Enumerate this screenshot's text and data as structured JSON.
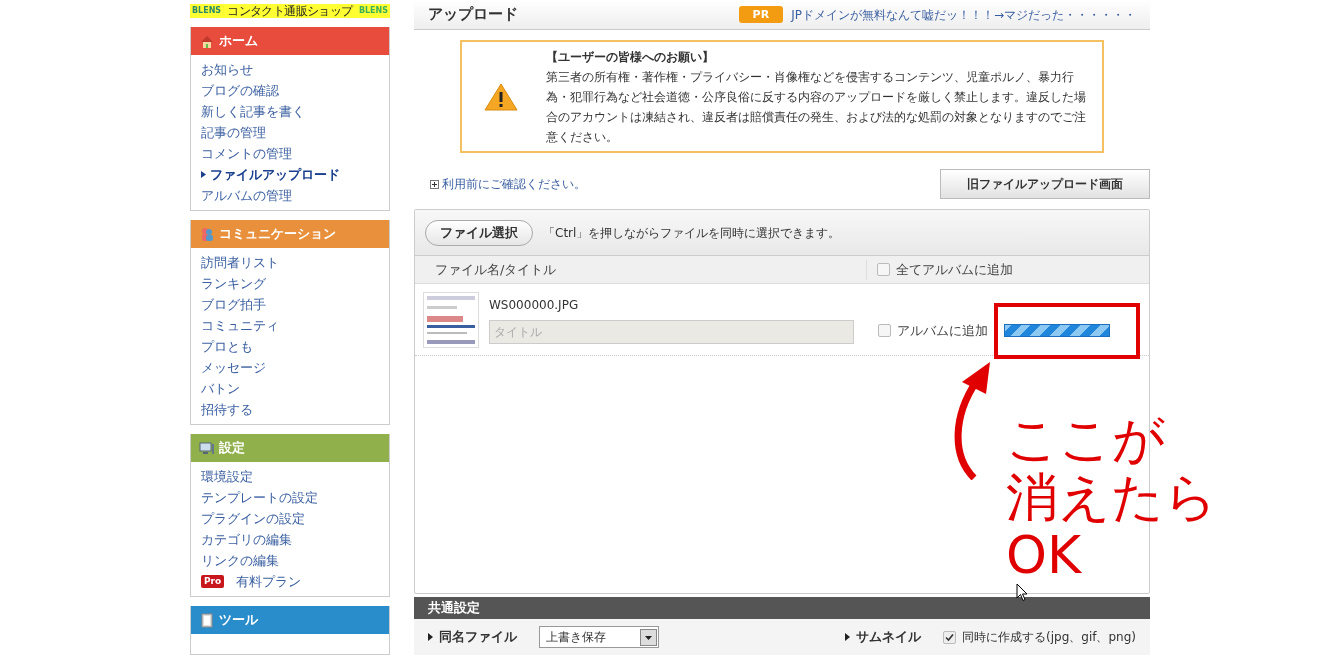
{
  "logo": {
    "brand": "BLENS",
    "tagline": "コンタクト通販ショップ",
    "brand_right": "BLENS"
  },
  "sidebar": [
    {
      "title": "ホーム",
      "kind": "home",
      "color": "#e84c3d",
      "items": [
        {
          "label": "お知らせ",
          "selected": false
        },
        {
          "label": "ブログの確認",
          "selected": false
        },
        {
          "label": "新しく記事を書く",
          "selected": false
        },
        {
          "label": "記事の管理",
          "selected": false
        },
        {
          "label": "コメントの管理",
          "selected": false
        },
        {
          "label": "ファイルアップロード",
          "selected": true
        },
        {
          "label": "アルバムの管理",
          "selected": false
        }
      ]
    },
    {
      "title": "コミュニケーション",
      "kind": "people",
      "color": "#e8903c",
      "items": [
        {
          "label": "訪問者リスト",
          "selected": false
        },
        {
          "label": "ランキング",
          "selected": false
        },
        {
          "label": "ブログ拍手",
          "selected": false
        },
        {
          "label": "コミュニティ",
          "selected": false
        },
        {
          "label": "プロとも",
          "selected": false
        },
        {
          "label": "メッセージ",
          "selected": false
        },
        {
          "label": "バトン",
          "selected": false
        },
        {
          "label": "招待する",
          "selected": false
        }
      ]
    },
    {
      "title": "設定",
      "kind": "monitor",
      "color": "#8fb04a",
      "items": [
        {
          "label": "環境設定",
          "selected": false
        },
        {
          "label": "テンプレートの設定",
          "selected": false
        },
        {
          "label": "プラグインの設定",
          "selected": false
        },
        {
          "label": "カテゴリの編集",
          "selected": false
        },
        {
          "label": "リンクの編集",
          "selected": false
        },
        {
          "label": "有料プラン",
          "selected": false,
          "badge": "Pro"
        }
      ]
    },
    {
      "title": "ツール",
      "kind": "book",
      "color": "#2a8dcb"
    }
  ],
  "header": {
    "title": "アップロード",
    "pr_badge": "PR",
    "pr_text": "JPドメインが無料なんて嘘だッ！！！→マジだった・・・・・・"
  },
  "notice": {
    "heading": "【ユーザーの皆様へのお願い】",
    "body": "第三者の所有権・著作権・プライバシー・肖像権などを侵害するコンテンツ、児童ポルノ、暴力行為・犯罪行為など社会道徳・公序良俗に反する内容のアップロードを厳しく禁止します。違反した場合のアカウントは凍結され、違反者は賠償責任の発生、および法的な処罰の対象となりますのでご注意ください。"
  },
  "help_link": "利用前にご確認ください。",
  "old_upload_button": "旧ファイルアップロード画面",
  "uploader": {
    "select_button": "ファイル選択",
    "hint": "「Ctrl」を押しながらファイルを同時に選択できます。",
    "column": "ファイル名/タイトル",
    "add_all": {
      "label": "全てアルバムに追加",
      "checked": false
    },
    "files": [
      {
        "level": 1,
        "name": "WS000000.JPG",
        "title_placeholder": "タイトル",
        "album": {
          "label": "アルバムに追加",
          "checked": false
        }
      }
    ]
  },
  "common_settings": {
    "title": "共通設定",
    "fields": [
      {
        "kind": "select",
        "label": "同名ファイル",
        "value": "上書き保存"
      },
      {
        "kind": "checkbox",
        "label": "サムネイル",
        "checked": true,
        "text": "同時に作成する(jpg、gif、png)"
      }
    ]
  },
  "annotation": {
    "lines": [
      "ここが",
      "消えたら",
      "OK"
    ]
  }
}
